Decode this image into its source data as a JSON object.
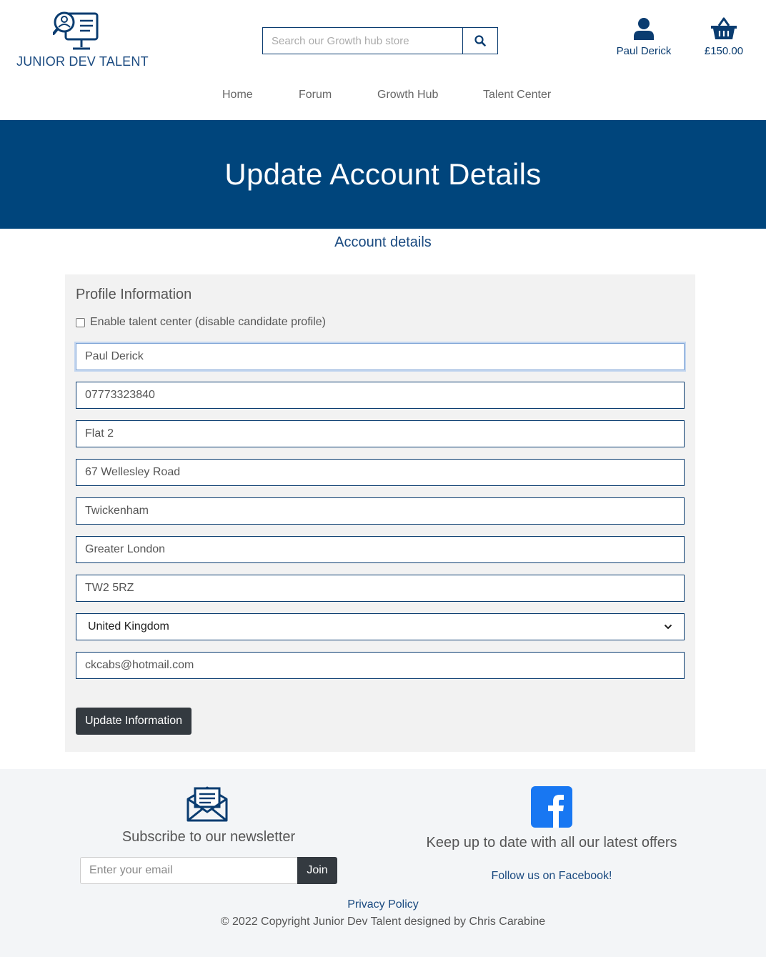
{
  "brand": {
    "logo_text": "JUNIOR DEV TALENT",
    "primary_color": "#00457c",
    "dark_button_color": "#343a40",
    "facebook_color": "#1877f2"
  },
  "search": {
    "placeholder": "Search our Growth hub store",
    "icon": "search-icon"
  },
  "account": {
    "name": "Paul Derick",
    "icon": "user-icon"
  },
  "basket": {
    "total": "£150.00",
    "icon": "basket-icon"
  },
  "nav": {
    "items": [
      {
        "label": "Home"
      },
      {
        "label": "Forum"
      },
      {
        "label": "Growth Hub"
      },
      {
        "label": "Talent Center"
      }
    ]
  },
  "banner": {
    "title": "Update Account Details"
  },
  "subtitle": "Account details",
  "profile": {
    "title": "Profile Information",
    "checkbox_label": "Enable talent center (disable candidate profile)",
    "checkbox_checked": false,
    "fields": [
      {
        "value": "Paul Derick"
      },
      {
        "value": "07773323840"
      },
      {
        "value": "Flat 2"
      },
      {
        "value": "67 Wellesley Road"
      },
      {
        "value": "Twickenham"
      },
      {
        "value": "Greater London"
      },
      {
        "value": "TW2 5RZ"
      }
    ],
    "country": "United Kingdom",
    "email": "ckcabs@hotmail.com",
    "submit_label": "Update Information"
  },
  "footer": {
    "newsletter_title": "Subscribe to our newsletter",
    "newsletter_placeholder": "Enter your email",
    "join_label": "Join",
    "offers_text": "Keep up to date with all our latest offers",
    "facebook_link": "Follow us on Facebook!",
    "privacy_label": "Privacy Policy",
    "copyright": "© 2022 Copyright Junior Dev Talent designed by Chris Carabine"
  }
}
